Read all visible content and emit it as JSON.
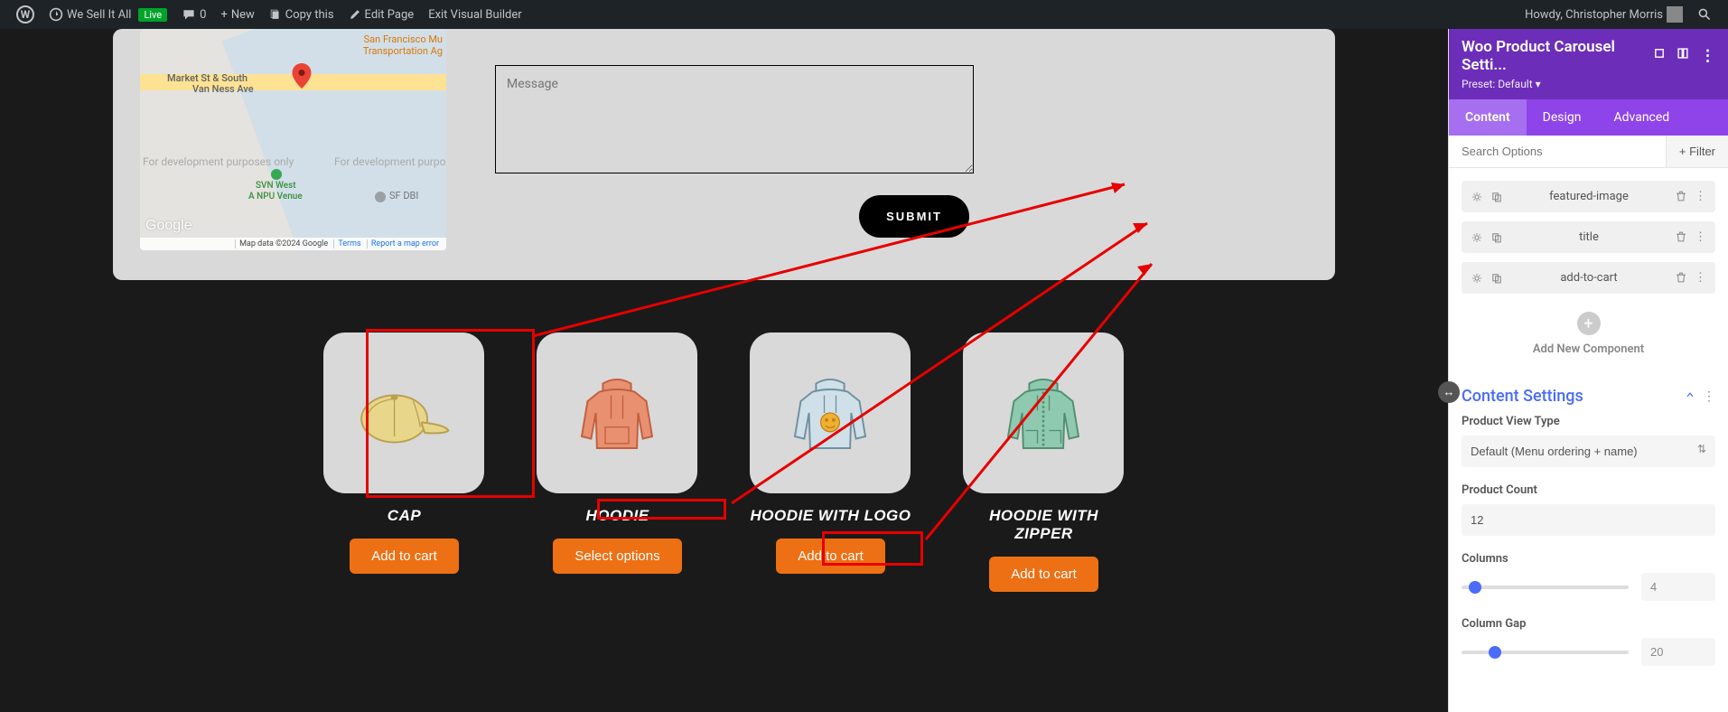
{
  "adminBar": {
    "siteName": "We Sell It All",
    "liveBadge": "Live",
    "commentCount": "0",
    "newLabel": "New",
    "copyLabel": "Copy this",
    "editLabel": "Edit Page",
    "exitLabel": "Exit Visual Builder",
    "howdy": "Howdy, Christopher Morris"
  },
  "contact": {
    "messagePlaceholder": "Message",
    "submitLabel": "SUBMIT",
    "map": {
      "devText1": "For development purposes only",
      "devText2": "For development purpo",
      "googleLabel": "Google",
      "footer": {
        "mapdata": "Map data ©2024 Google",
        "terms": "Terms",
        "report": "Report a map error"
      },
      "labels": {
        "sf": "San Francisco Mu",
        "transport": "Transportation Ag",
        "market": "Market St & South",
        "vanness": "Van Ness Ave",
        "svn": "SVN West",
        "npu": "A NPU Venue",
        "sfdbi": "SF DBI"
      }
    }
  },
  "products": [
    {
      "title": "CAP",
      "button": "Add to cart"
    },
    {
      "title": "HOODIE",
      "button": "Select options"
    },
    {
      "title": "HOODIE WITH LOGO",
      "button": "Add to cart"
    },
    {
      "title": "HOODIE WITH ZIPPER",
      "button": "Add to cart"
    }
  ],
  "panel": {
    "title": "Woo Product Carousel Setti...",
    "preset": "Preset: Default ▾",
    "tabs": {
      "content": "Content",
      "design": "Design",
      "advanced": "Advanced"
    },
    "searchPlaceholder": "Search Options",
    "filterLabel": "+ Filter",
    "components": [
      {
        "label": "featured-image"
      },
      {
        "label": "title"
      },
      {
        "label": "add-to-cart"
      }
    ],
    "addNewLabel": "Add New Component",
    "contentSettings": {
      "heading": "Content Settings",
      "viewType": {
        "label": "Product View Type",
        "value": "Default (Menu ordering + name)"
      },
      "productCount": {
        "label": "Product Count",
        "value": "12"
      },
      "columns": {
        "label": "Columns",
        "value": "4"
      },
      "columnGap": {
        "label": "Column Gap",
        "value": "20"
      }
    }
  }
}
